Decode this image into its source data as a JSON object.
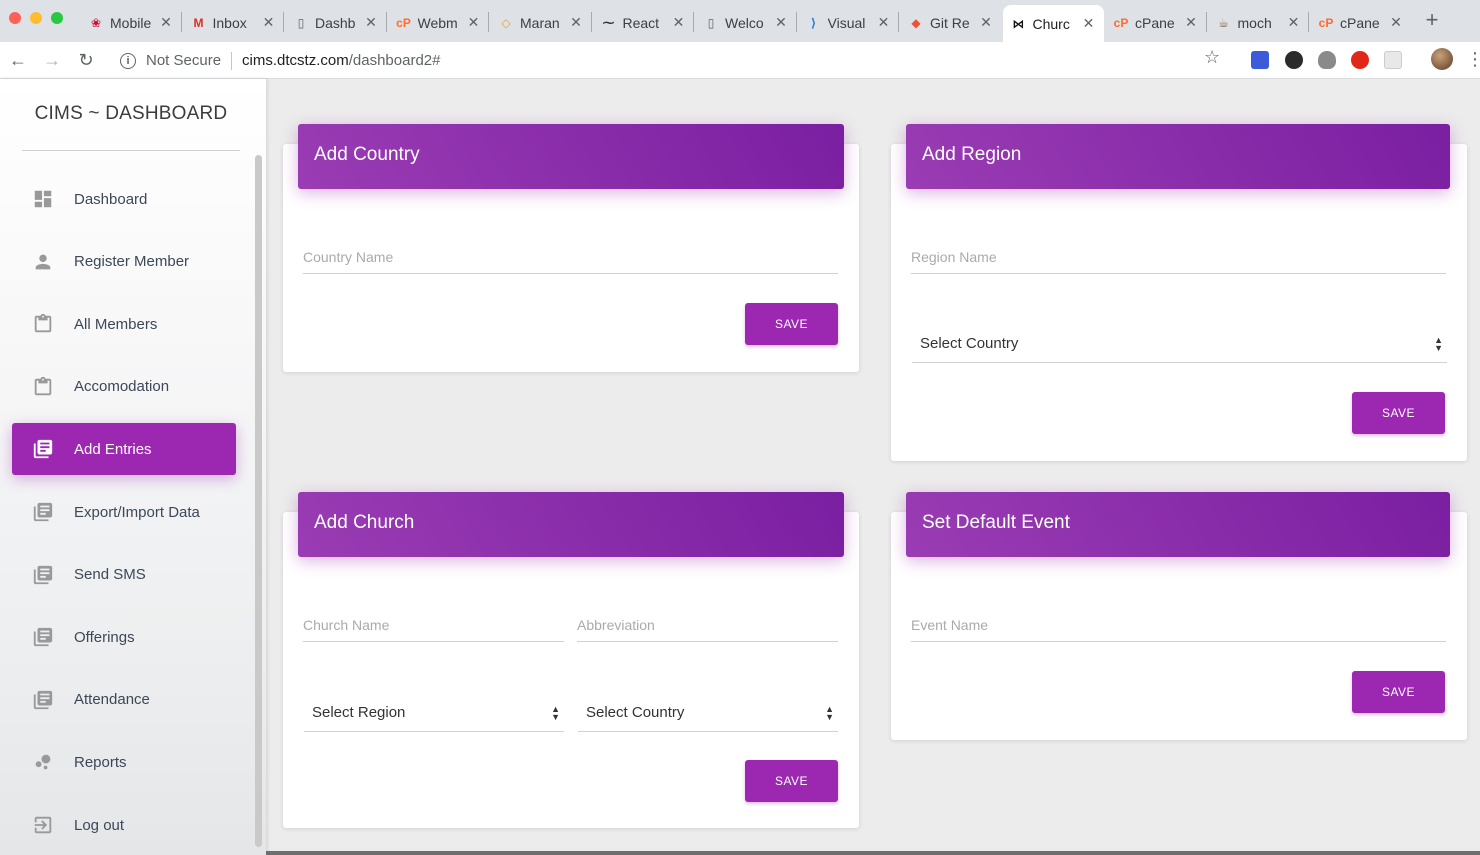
{
  "browser": {
    "tabs": [
      {
        "title": "Mobile",
        "icon": "huawei-icon",
        "color": "#cf0a2c"
      },
      {
        "title": "Inbox",
        "icon": "gmail-icon",
        "color": "#d93025"
      },
      {
        "title": "Dashb",
        "icon": "page-icon",
        "color": "#5f6368"
      },
      {
        "title": "Webm",
        "icon": "cpanel-icon",
        "color": "#ff6c2c"
      },
      {
        "title": "Maran",
        "icon": "graduation-cap-icon",
        "color": "#e0a030"
      },
      {
        "title": "React",
        "icon": "mustache-icon",
        "color": "#333333"
      },
      {
        "title": "Welco",
        "icon": "page-icon",
        "color": "#5f6368"
      },
      {
        "title": "Visual",
        "icon": "vscode-icon",
        "color": "#2b7bd9"
      },
      {
        "title": "Git Re",
        "icon": "git-icon",
        "color": "#f05033"
      },
      {
        "title": "Churc",
        "icon": "bowtie-icon",
        "color": "#111111"
      },
      {
        "title": "cPane",
        "icon": "cpanel-icon",
        "color": "#ff6c2c"
      },
      {
        "title": "moch",
        "icon": "mocha-icon",
        "color": "#8d6748"
      },
      {
        "title": "cPane",
        "icon": "cpanel-icon",
        "color": "#ff6c2c"
      }
    ],
    "active_tab_index": 9,
    "security_label": "Not Secure",
    "url_host": "cims.dtcstz.com",
    "url_path": "/dashboard2#"
  },
  "sidebar": {
    "brand": "CIMS ~ DASHBOARD",
    "items": [
      {
        "label": "Dashboard",
        "icon": "dashboard-grid-icon"
      },
      {
        "label": "Register Member",
        "icon": "person-icon"
      },
      {
        "label": "All Members",
        "icon": "clipboard-icon"
      },
      {
        "label": "Accomodation",
        "icon": "clipboard-icon"
      },
      {
        "label": "Add Entries",
        "icon": "library-books-icon",
        "active": true
      },
      {
        "label": "Export/Import Data",
        "icon": "library-books-icon"
      },
      {
        "label": "Send SMS",
        "icon": "library-books-icon"
      },
      {
        "label": "Offerings",
        "icon": "library-books-icon"
      },
      {
        "label": "Attendance",
        "icon": "library-books-icon"
      },
      {
        "label": "Reports",
        "icon": "bubble-chart-icon"
      },
      {
        "label": "Log out",
        "icon": "logout-icon"
      }
    ]
  },
  "cards": {
    "country": {
      "title": "Add Country",
      "name_placeholder": "Country Name",
      "save_label": "SAVE"
    },
    "region": {
      "title": "Add Region",
      "name_placeholder": "Region Name",
      "country_select": "Select Country",
      "save_label": "SAVE"
    },
    "church": {
      "title": "Add Church",
      "name_placeholder": "Church Name",
      "abbr_placeholder": "Abbreviation",
      "region_select": "Select Region",
      "country_select": "Select Country",
      "save_label": "SAVE"
    },
    "event": {
      "title": "Set Default Event",
      "name_placeholder": "Event Name",
      "save_label": "SAVE"
    }
  },
  "colors": {
    "accent": "#9c27b0",
    "header_gradient_start": "#9a3cb3",
    "header_gradient_end": "#7b1fa2"
  }
}
